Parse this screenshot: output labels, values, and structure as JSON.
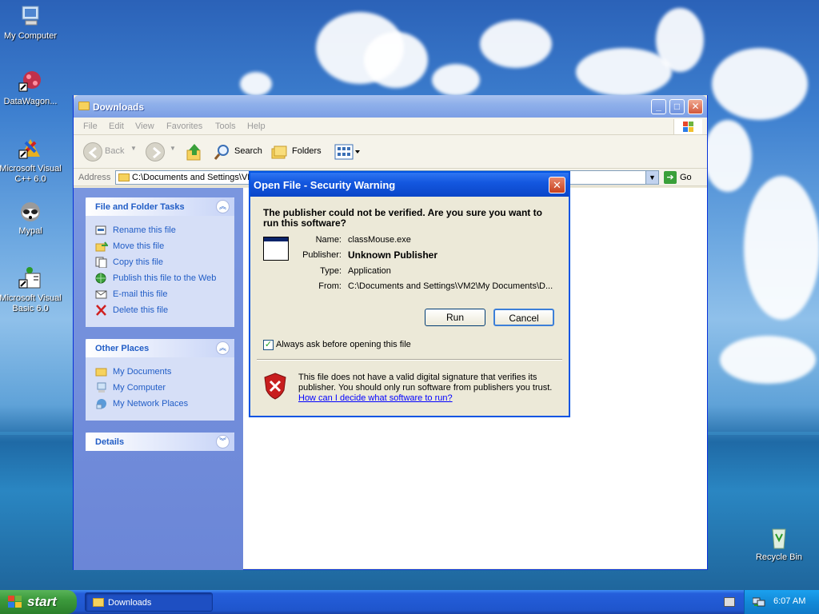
{
  "desktop": {
    "icons": [
      {
        "label": "My Computer"
      },
      {
        "label": "DataWagon..."
      },
      {
        "label": "Microsoft Visual C++ 6.0"
      },
      {
        "label": "Mypal"
      },
      {
        "label": "Microsoft Visual Basic 6.0"
      },
      {
        "label": "Recycle Bin"
      }
    ]
  },
  "explorer": {
    "title": "Downloads",
    "menu": [
      "File",
      "Edit",
      "View",
      "Favorites",
      "Tools",
      "Help"
    ],
    "toolbar": {
      "back": "Back",
      "search": "Search",
      "folders": "Folders"
    },
    "address": {
      "label": "Address",
      "value": "C:\\Documents and Settings\\VM",
      "go": "Go"
    },
    "file_folder_tasks": {
      "title": "File and Folder Tasks",
      "items": [
        "Rename this file",
        "Move this file",
        "Copy this file",
        "Publish this file to the Web",
        "E-mail this file",
        "Delete this file"
      ]
    },
    "other_places": {
      "title": "Other Places",
      "items": [
        "My Documents",
        "My Computer",
        "My Network Places"
      ]
    },
    "details": {
      "title": "Details"
    }
  },
  "dialog": {
    "title": "Open File - Security Warning",
    "question": "The publisher could not be verified.  Are you sure you want to run this software?",
    "fields": [
      {
        "key": "Name:",
        "value": "classMouse.exe"
      },
      {
        "key": "Publisher:",
        "value": "Unknown Publisher"
      },
      {
        "key": "Type:",
        "value": "Application"
      },
      {
        "key": "From:",
        "value": "C:\\Documents and Settings\\VM2\\My Documents\\D..."
      }
    ],
    "run": "Run",
    "cancel": "Cancel",
    "checkbox": {
      "label": "Always ask before opening this file",
      "checked": true
    },
    "warning": "This file does not have a valid digital signature that verifies its publisher.  You should only run software from publishers you trust.",
    "link": "How can I decide what software to run?"
  },
  "taskbar": {
    "start": "start",
    "task": "Downloads",
    "clock": "6:07 AM"
  }
}
